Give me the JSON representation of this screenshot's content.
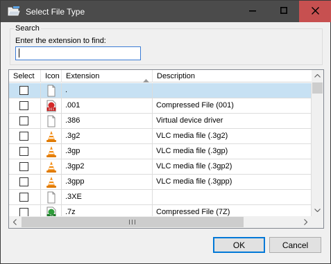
{
  "window": {
    "title": "Select File Type",
    "icon": "open-folder-icon",
    "controls": [
      "minimize-icon",
      "maximize-icon",
      "close-icon"
    ],
    "close_color": "#c75050",
    "titlebar_color": "#4b4b4b"
  },
  "search": {
    "legend": "Search",
    "label": "Enter the extension to find:",
    "value": "",
    "placeholder": ""
  },
  "grid": {
    "columns": [
      "Select",
      "Icon",
      "Extension",
      "Description"
    ],
    "sort_column": "Extension",
    "sort_direction": "ascending",
    "selection_color": "#c7e1f3",
    "rows": [
      {
        "checked": false,
        "icon": "generic-file-icon",
        "extension": ".",
        "description": "",
        "selected": true
      },
      {
        "checked": false,
        "icon": "compressed-001-icon",
        "extension": ".001",
        "description": "Compressed File (001)",
        "selected": false
      },
      {
        "checked": false,
        "icon": "generic-file-icon",
        "extension": ".386",
        "description": "Virtual device driver",
        "selected": false
      },
      {
        "checked": false,
        "icon": "vlc-cone-icon",
        "extension": ".3g2",
        "description": "VLC media file (.3g2)",
        "selected": false
      },
      {
        "checked": false,
        "icon": "vlc-cone-icon",
        "extension": ".3gp",
        "description": "VLC media file (.3gp)",
        "selected": false
      },
      {
        "checked": false,
        "icon": "vlc-cone-icon",
        "extension": ".3gp2",
        "description": "VLC media file (.3gp2)",
        "selected": false
      },
      {
        "checked": false,
        "icon": "vlc-cone-icon",
        "extension": ".3gpp",
        "description": "VLC media file (.3gpp)",
        "selected": false
      },
      {
        "checked": false,
        "icon": "generic-file-icon",
        "extension": ".3XE",
        "description": "",
        "selected": false
      },
      {
        "checked": false,
        "icon": "7z-archive-icon",
        "extension": ".7z",
        "description": "Compressed File (7Z)",
        "selected": false
      }
    ]
  },
  "buttons": {
    "ok": "OK",
    "cancel": "Cancel"
  }
}
